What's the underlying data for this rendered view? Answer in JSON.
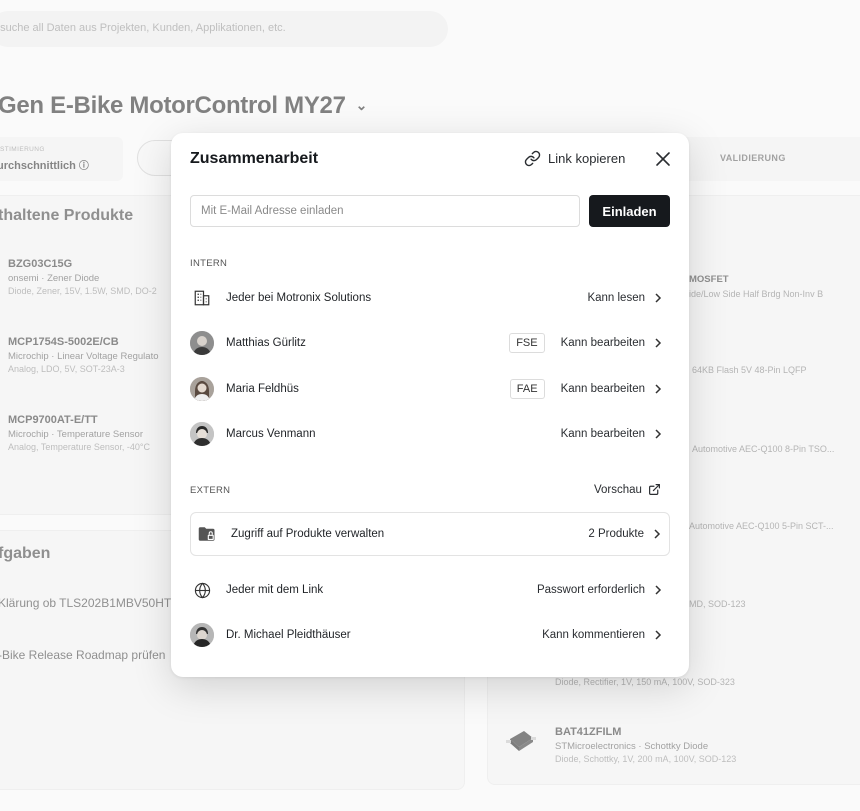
{
  "background": {
    "search_placeholder": "ttsuche all Daten aus Projekten, Kunden, Applikationen, etc.",
    "project_title": "Gen E-Bike MotorControl MY27",
    "timing_label": "STIMIERUNG",
    "timing_value": "urchschnittlich",
    "stage_label": "VALIDIERUNG",
    "products_title": "thaltene Produkte",
    "products": [
      {
        "name": "BZG03C15G",
        "maker": "onsemi · Zener Diode",
        "desc": "Diode, Zener, 15V, 1.5W, SMD, DO-2"
      },
      {
        "name": "MCP1754S-5002E/CB",
        "maker": "Microchip · Linear Voltage Regulato",
        "desc": "Analog, LDO, 5V, SOT-23A-3"
      },
      {
        "name": "MCP9700AT-E/TT",
        "maker": "Microchip · Temperature Sensor",
        "desc": "Analog, Temperature Sensor, -40°C"
      }
    ],
    "right_products": [
      "MOSFET",
      "ide/Low Side Half Brdg Non-Inv B",
      "64KB Flash 5V 48-Pin LQFP",
      "Automotive AEC-Q100 8-Pin TSO...",
      "Automotive AEC-Q100 5-Pin SCT-...",
      "MD, SOD-123",
      "Diode, Rectifier, 1V, 150 mA, 100V, SOD-323"
    ],
    "bat": {
      "name": "BAT41ZFILM",
      "maker": "STMicroelectronics · Schottky Diode",
      "desc": "Diode, Schottky, 1V, 200 mA, 100V, SOD-123"
    },
    "tasks_title": "fgaben",
    "tasks": [
      "Klärung ob TLS202B1MBV50HT",
      "-Bike Release Roadmap prüfen"
    ]
  },
  "modal": {
    "title": "Zusammenarbeit",
    "copy_link": "Link kopieren",
    "email_placeholder": "Mit E-Mail Adresse einladen",
    "invite_button": "Einladen",
    "intern_label": "INTERN",
    "extern_label": "EXTERN",
    "preview_label": "Vorschau",
    "intern_rows": [
      {
        "label": "Jeder bei Motronix Solutions",
        "permission": "Kann lesen",
        "icon": "building-icon"
      },
      {
        "label": "Matthias Gürlitz",
        "badge": "FSE",
        "permission": "Kann bearbeiten",
        "icon": "avatar"
      },
      {
        "label": "Maria Feldhüs",
        "badge": "FAE",
        "permission": "Kann bearbeiten",
        "icon": "avatar"
      },
      {
        "label": "Marcus Venmann",
        "permission": "Kann bearbeiten",
        "icon": "avatar"
      }
    ],
    "extern_rows": [
      {
        "label": "Zugriff auf Produkte verwalten",
        "permission": "2 Produkte",
        "icon": "folder-lock-icon"
      },
      {
        "label": "Jeder mit dem Link",
        "permission": "Passwort erforderlich",
        "icon": "globe-icon"
      },
      {
        "label": "Dr. Michael Pleidthäuser",
        "permission": "Kann kommentieren",
        "icon": "avatar"
      }
    ]
  }
}
